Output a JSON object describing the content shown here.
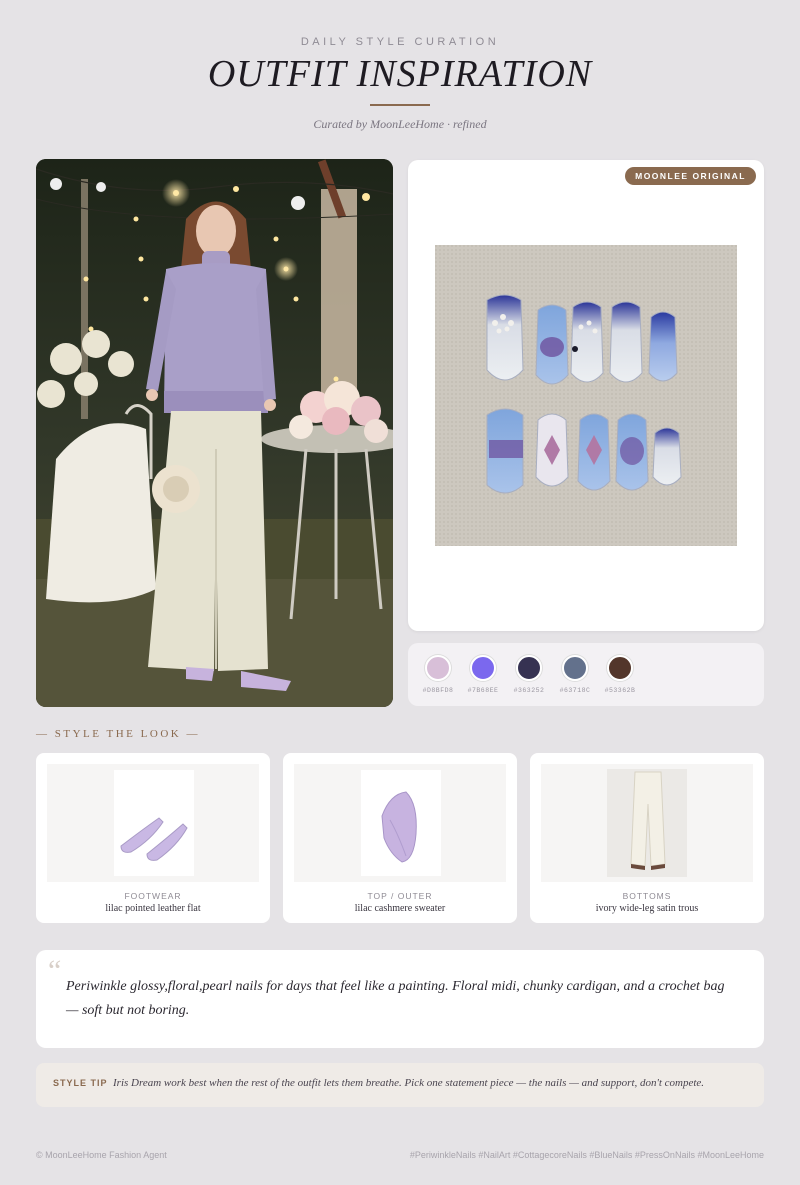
{
  "header": {
    "eyebrow": "DAILY STYLE CURATION",
    "title": "OUTFIT INSPIRATION",
    "curated": "Curated by MoonLeeHome · refined"
  },
  "nail_card": {
    "badge": "MOONLEE ORIGINAL"
  },
  "palette": [
    {
      "hex": "#D8BFD8",
      "color": "#D8BFD8"
    },
    {
      "hex": "#7B68EE",
      "color": "#7B68EE"
    },
    {
      "hex": "#363252",
      "color": "#363252"
    },
    {
      "hex": "#63718C",
      "color": "#63718C"
    },
    {
      "hex": "#53362B",
      "color": "#53362B"
    }
  ],
  "style_section": {
    "label": "— STYLE THE LOOK —"
  },
  "items": [
    {
      "category": "FOOTWEAR",
      "name": "lilac pointed leather flat",
      "icon": "shoe-icon"
    },
    {
      "category": "TOP / OUTER",
      "name": "lilac cashmere sweater",
      "icon": "sweater-icon"
    },
    {
      "category": "BOTTOMS",
      "name": "ivory wide-leg satin trous",
      "icon": "trousers-icon"
    }
  ],
  "quote": {
    "mark": "“",
    "text": "Periwinkle glossy,floral,pearl nails for days that feel like a painting. Floral midi, chunky cardigan, and a crochet bag — soft but not boring."
  },
  "tip": {
    "label": "STYLE TIP",
    "text": "Iris Dream work best when the rest of the outfit lets them breathe. Pick one statement piece — the nails — and support, don't compete."
  },
  "footer": {
    "left": "© MoonLeeHome Fashion Agent",
    "right": "#PeriwinkleNails #NailArt #CottagecoreNails #BlueNails #PressOnNails #MoonLeeHome"
  }
}
